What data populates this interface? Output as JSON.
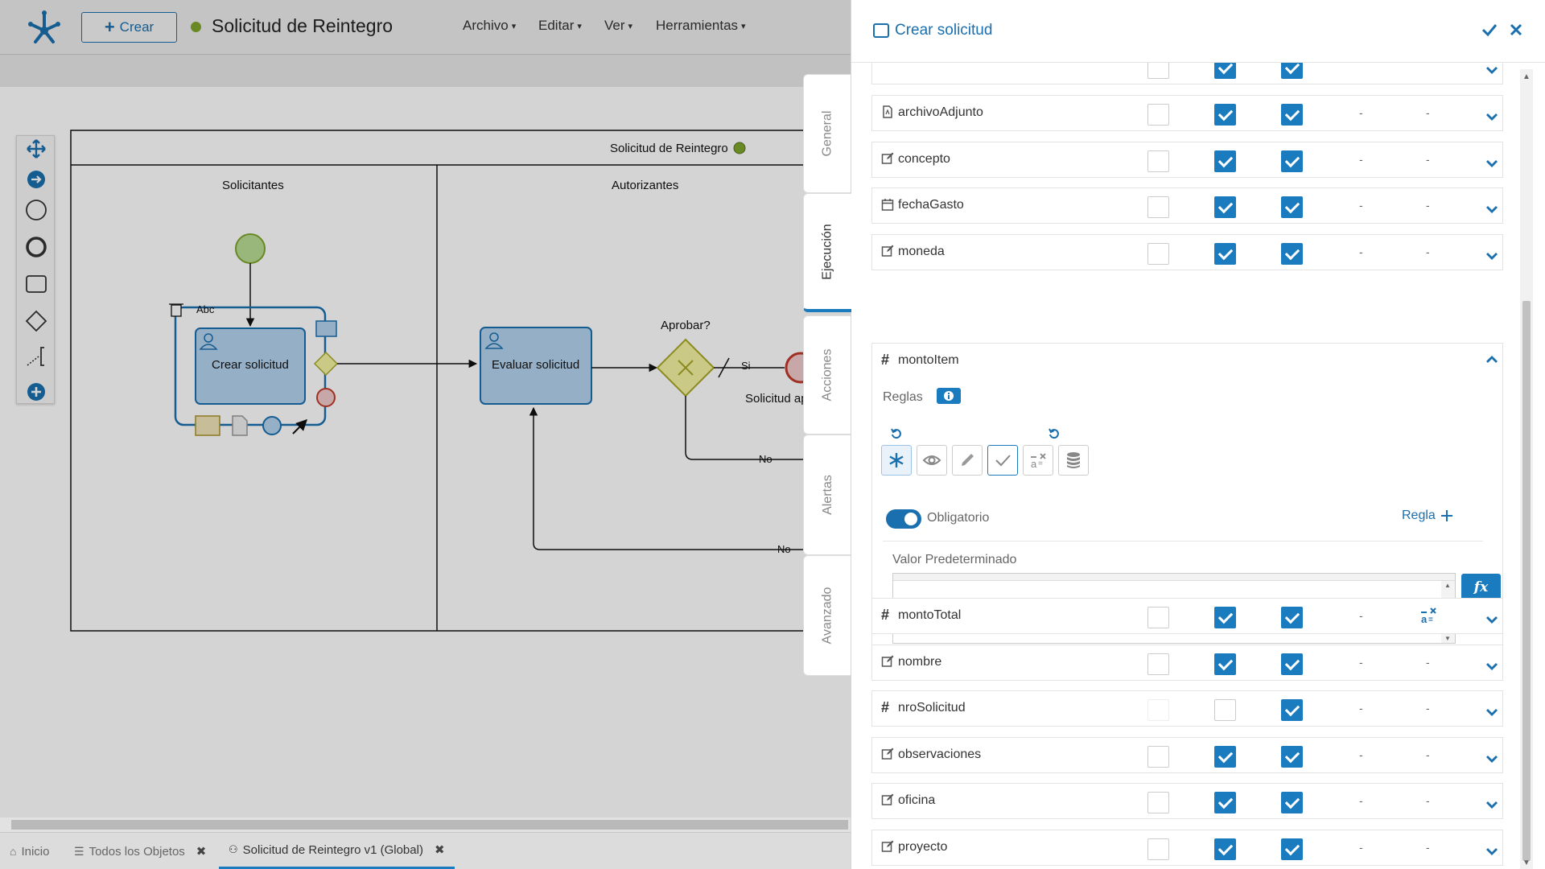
{
  "app": {
    "crear_label": "Crear",
    "title": "Solicitud de Reintegro",
    "status_color": "#7fa52d",
    "accent_color": "#1a7bbf",
    "menus": [
      "Archivo",
      "Editar",
      "Ver",
      "Herramientas"
    ]
  },
  "toolbar": {
    "icons": [
      "save-icon",
      "validate-icon",
      "run-icon",
      "export-icon",
      "undo-icon",
      "redo-icon",
      "zoom-in-icon",
      "zoom-out-icon"
    ]
  },
  "palette": {
    "icons": [
      "move-icon",
      "arrow-right-icon",
      "start-event-icon",
      "end-event-icon",
      "task-icon",
      "gateway-icon",
      "annotation-icon",
      "add-icon"
    ]
  },
  "diagram": {
    "pool_title": "Solicitud de Reintegro",
    "lanes": [
      "Solicitantes",
      "Autorizantes"
    ],
    "task_crear": "Crear solicitud",
    "task_evaluar": "Evaluar solicitud",
    "gateway_label": "Aprobar?",
    "flow_si": "Si",
    "flow_no_1": "No",
    "flow_no_2": "No",
    "end_label": "Solicitud ap",
    "abc_label": "Abc"
  },
  "side_tabs": [
    "General",
    "Ejecución",
    "Acciones",
    "Alertas",
    "Avanzado"
  ],
  "bottom_tabs": [
    {
      "label": "Inicio",
      "icon": "home-icon"
    },
    {
      "label": "Todos los Objetos",
      "icon": "list-icon"
    },
    {
      "label": "Solicitud de Reintegro v1 (Global)",
      "icon": "process-icon"
    }
  ],
  "panel": {
    "title": "Crear solicitud",
    "rows_top": [
      {
        "name": "archivoAdjunto",
        "icon": "file-icon",
        "c1": false,
        "c2": true,
        "c3": true,
        "d1": "-",
        "d2": "-"
      },
      {
        "name": "concepto",
        "icon": "edit-icon",
        "c1": false,
        "c2": true,
        "c3": true,
        "d1": "-",
        "d2": "-"
      },
      {
        "name": "fechaGasto",
        "icon": "calendar-icon",
        "c1": false,
        "c2": true,
        "c3": true,
        "d1": "-",
        "d2": "-"
      },
      {
        "name": "moneda",
        "icon": "edit-icon",
        "c1": false,
        "c2": true,
        "c3": true,
        "d1": "-",
        "d2": "-"
      }
    ],
    "expanded": {
      "name": "montoItem",
      "icon": "hash-icon",
      "reglas_label": "Reglas",
      "rule_buttons": [
        "asterisk-icon",
        "eye-icon",
        "pencil-icon",
        "check-icon",
        "calc-icon",
        "database-icon"
      ],
      "obligatorio_label": "Obligatorio",
      "obligatorio_on": true,
      "regla_label": "Regla",
      "valor_label": "Valor Predeterminado"
    },
    "rows_bottom": [
      {
        "name": "montoTotal",
        "icon": "hash-icon",
        "c1": false,
        "c2": true,
        "c3": true,
        "d1": "-",
        "d2": ""
      },
      {
        "name": "nombre",
        "icon": "edit-icon",
        "c1": false,
        "c2": true,
        "c3": true,
        "d1": "-",
        "d2": "-"
      },
      {
        "name": "nroSolicitud",
        "icon": "hash-icon",
        "c1": false,
        "c2": false,
        "c3": true,
        "d1": "-",
        "d2": "-"
      },
      {
        "name": "observaciones",
        "icon": "edit-icon",
        "c1": false,
        "c2": true,
        "c3": true,
        "d1": "-",
        "d2": "-"
      },
      {
        "name": "oficina",
        "icon": "edit-icon",
        "c1": false,
        "c2": true,
        "c3": true,
        "d1": "-",
        "d2": "-"
      },
      {
        "name": "proyecto",
        "icon": "edit-icon",
        "c1": false,
        "c2": true,
        "c3": true,
        "d1": "-",
        "d2": "-"
      }
    ]
  }
}
